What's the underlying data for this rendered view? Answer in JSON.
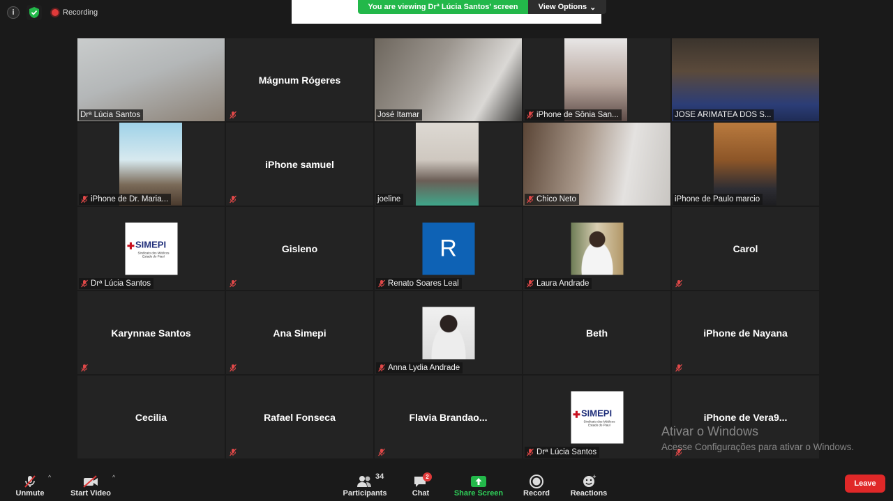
{
  "status": {
    "recording_label": "Recording"
  },
  "share": {
    "banner": "You are viewing Drª Lúcia Santos' screen",
    "view_options": "View Options"
  },
  "tiles": [
    {
      "name": "Drª Lúcia Santos",
      "muted": false,
      "kind": "video"
    },
    {
      "name": "Mágnum Rógeres",
      "muted": true,
      "kind": "name"
    },
    {
      "name": "José Itamar",
      "muted": false,
      "kind": "video"
    },
    {
      "name": "iPhone de Sônia San...",
      "muted": true,
      "kind": "video"
    },
    {
      "name": "JOSE ARIMATEA DOS S...",
      "muted": false,
      "kind": "video",
      "speaking": true
    },
    {
      "name": "iPhone de Dr. Maria...",
      "muted": true,
      "kind": "video"
    },
    {
      "name": "iPhone samuel",
      "muted": true,
      "kind": "name"
    },
    {
      "name": "joeline",
      "muted": false,
      "kind": "video"
    },
    {
      "name": "Chico Neto",
      "muted": true,
      "kind": "video"
    },
    {
      "name": "iPhone de Paulo marcio",
      "muted": false,
      "kind": "video"
    },
    {
      "name": "Drª Lúcia Santos",
      "muted": true,
      "kind": "logo",
      "logo_title": "SIMEPI",
      "logo_sub": "Sindicato dos Médicos Estado do Piauí"
    },
    {
      "name": "Gisleno",
      "muted": true,
      "kind": "name"
    },
    {
      "name": "Renato Soares Leal",
      "muted": true,
      "kind": "letter",
      "letter": "R"
    },
    {
      "name": "Laura Andrade",
      "muted": true,
      "kind": "photo"
    },
    {
      "name": "Carol",
      "muted": true,
      "kind": "name"
    },
    {
      "name": "Karynnae Santos",
      "muted": true,
      "kind": "name"
    },
    {
      "name": "Ana Simepi",
      "muted": true,
      "kind": "name"
    },
    {
      "name": "Anna Lydia Andrade",
      "muted": true,
      "kind": "photo"
    },
    {
      "name": "Beth",
      "muted": false,
      "kind": "name"
    },
    {
      "name": "iPhone de Nayana",
      "muted": true,
      "kind": "name"
    },
    {
      "name": "Cecilia",
      "muted": false,
      "kind": "name"
    },
    {
      "name": "Rafael Fonseca",
      "muted": true,
      "kind": "name"
    },
    {
      "name": "Flavia  Brandao...",
      "muted": true,
      "kind": "name"
    },
    {
      "name": "Drª Lúcia Santos",
      "muted": true,
      "kind": "logo",
      "logo_title": "SIMEPI",
      "logo_sub": "Sindicato dos Médicos Estado do Piauí"
    },
    {
      "name": "iPhone  de  Vera9...",
      "muted": true,
      "kind": "name"
    }
  ],
  "toolbar": {
    "unmute": "Unmute",
    "start_video": "Start Video",
    "participants": "Participants",
    "participants_count": "34",
    "chat": "Chat",
    "chat_badge": "2",
    "share_screen": "Share Screen",
    "record": "Record",
    "reactions": "Reactions",
    "leave": "Leave"
  },
  "watermark": {
    "title": "Ativar o Windows",
    "subtitle": "Acesse Configurações para ativar o Windows."
  },
  "colors": {
    "accent_green": "#23b84a",
    "leave_red": "#e02828",
    "speaker_outline": "#d8e000",
    "muted_red": "#e03a3a"
  }
}
